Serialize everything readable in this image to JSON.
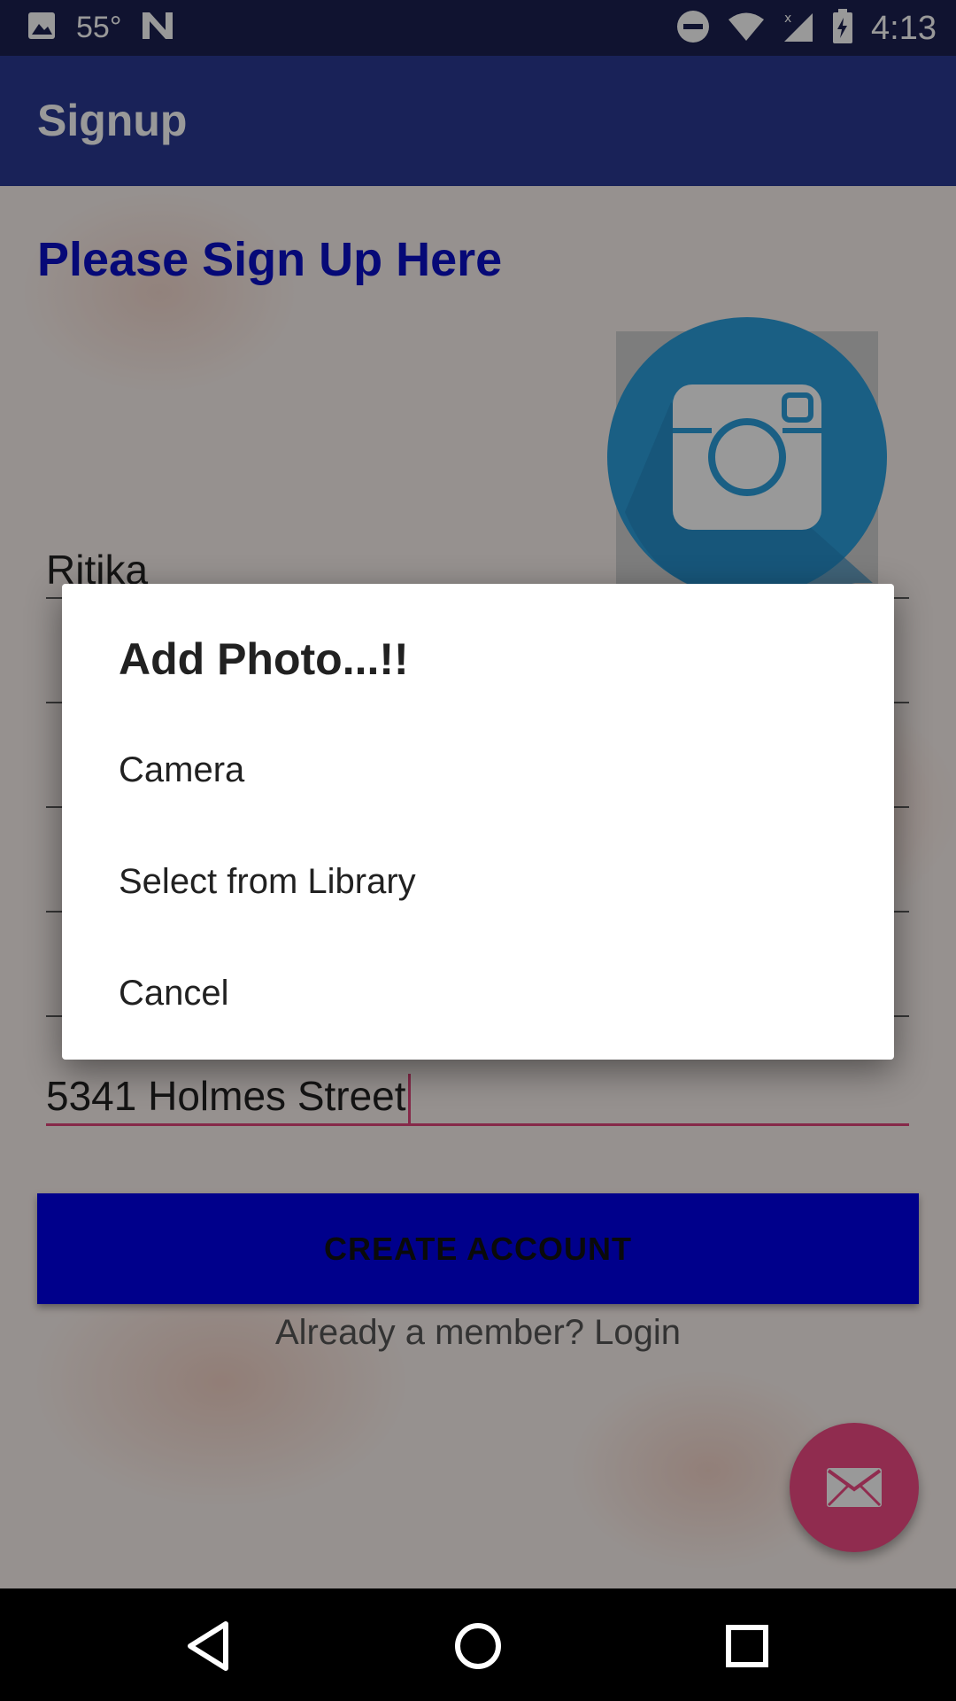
{
  "status_bar": {
    "temperature": "55°",
    "time": "4:13",
    "icons": [
      "image-icon",
      "n-icon",
      "do-not-disturb-icon",
      "wifi-icon",
      "signal-icon",
      "battery-icon"
    ]
  },
  "app_bar": {
    "title": "Signup"
  },
  "form": {
    "heading": "Please Sign Up Here",
    "first_name": "Ritika",
    "address": "5341 Holmes Street",
    "create_button": "CREATE ACCOUNT",
    "login_link": "Already a member? Login",
    "photo_icon": "camera-icon",
    "fab_icon": "mail-icon"
  },
  "dialog": {
    "title": "Add Photo...!!",
    "options": [
      "Camera",
      "Select from Library",
      "Cancel"
    ]
  },
  "nav_bar": {
    "icons": [
      "back-icon",
      "home-icon",
      "recents-icon"
    ]
  },
  "colors": {
    "status_bar": "#1b2150",
    "app_bar": "#2a3a93",
    "heading": "#0b0fc7",
    "button": "#0000e8",
    "accent": "#e0457b",
    "fab": "#f04a84"
  }
}
